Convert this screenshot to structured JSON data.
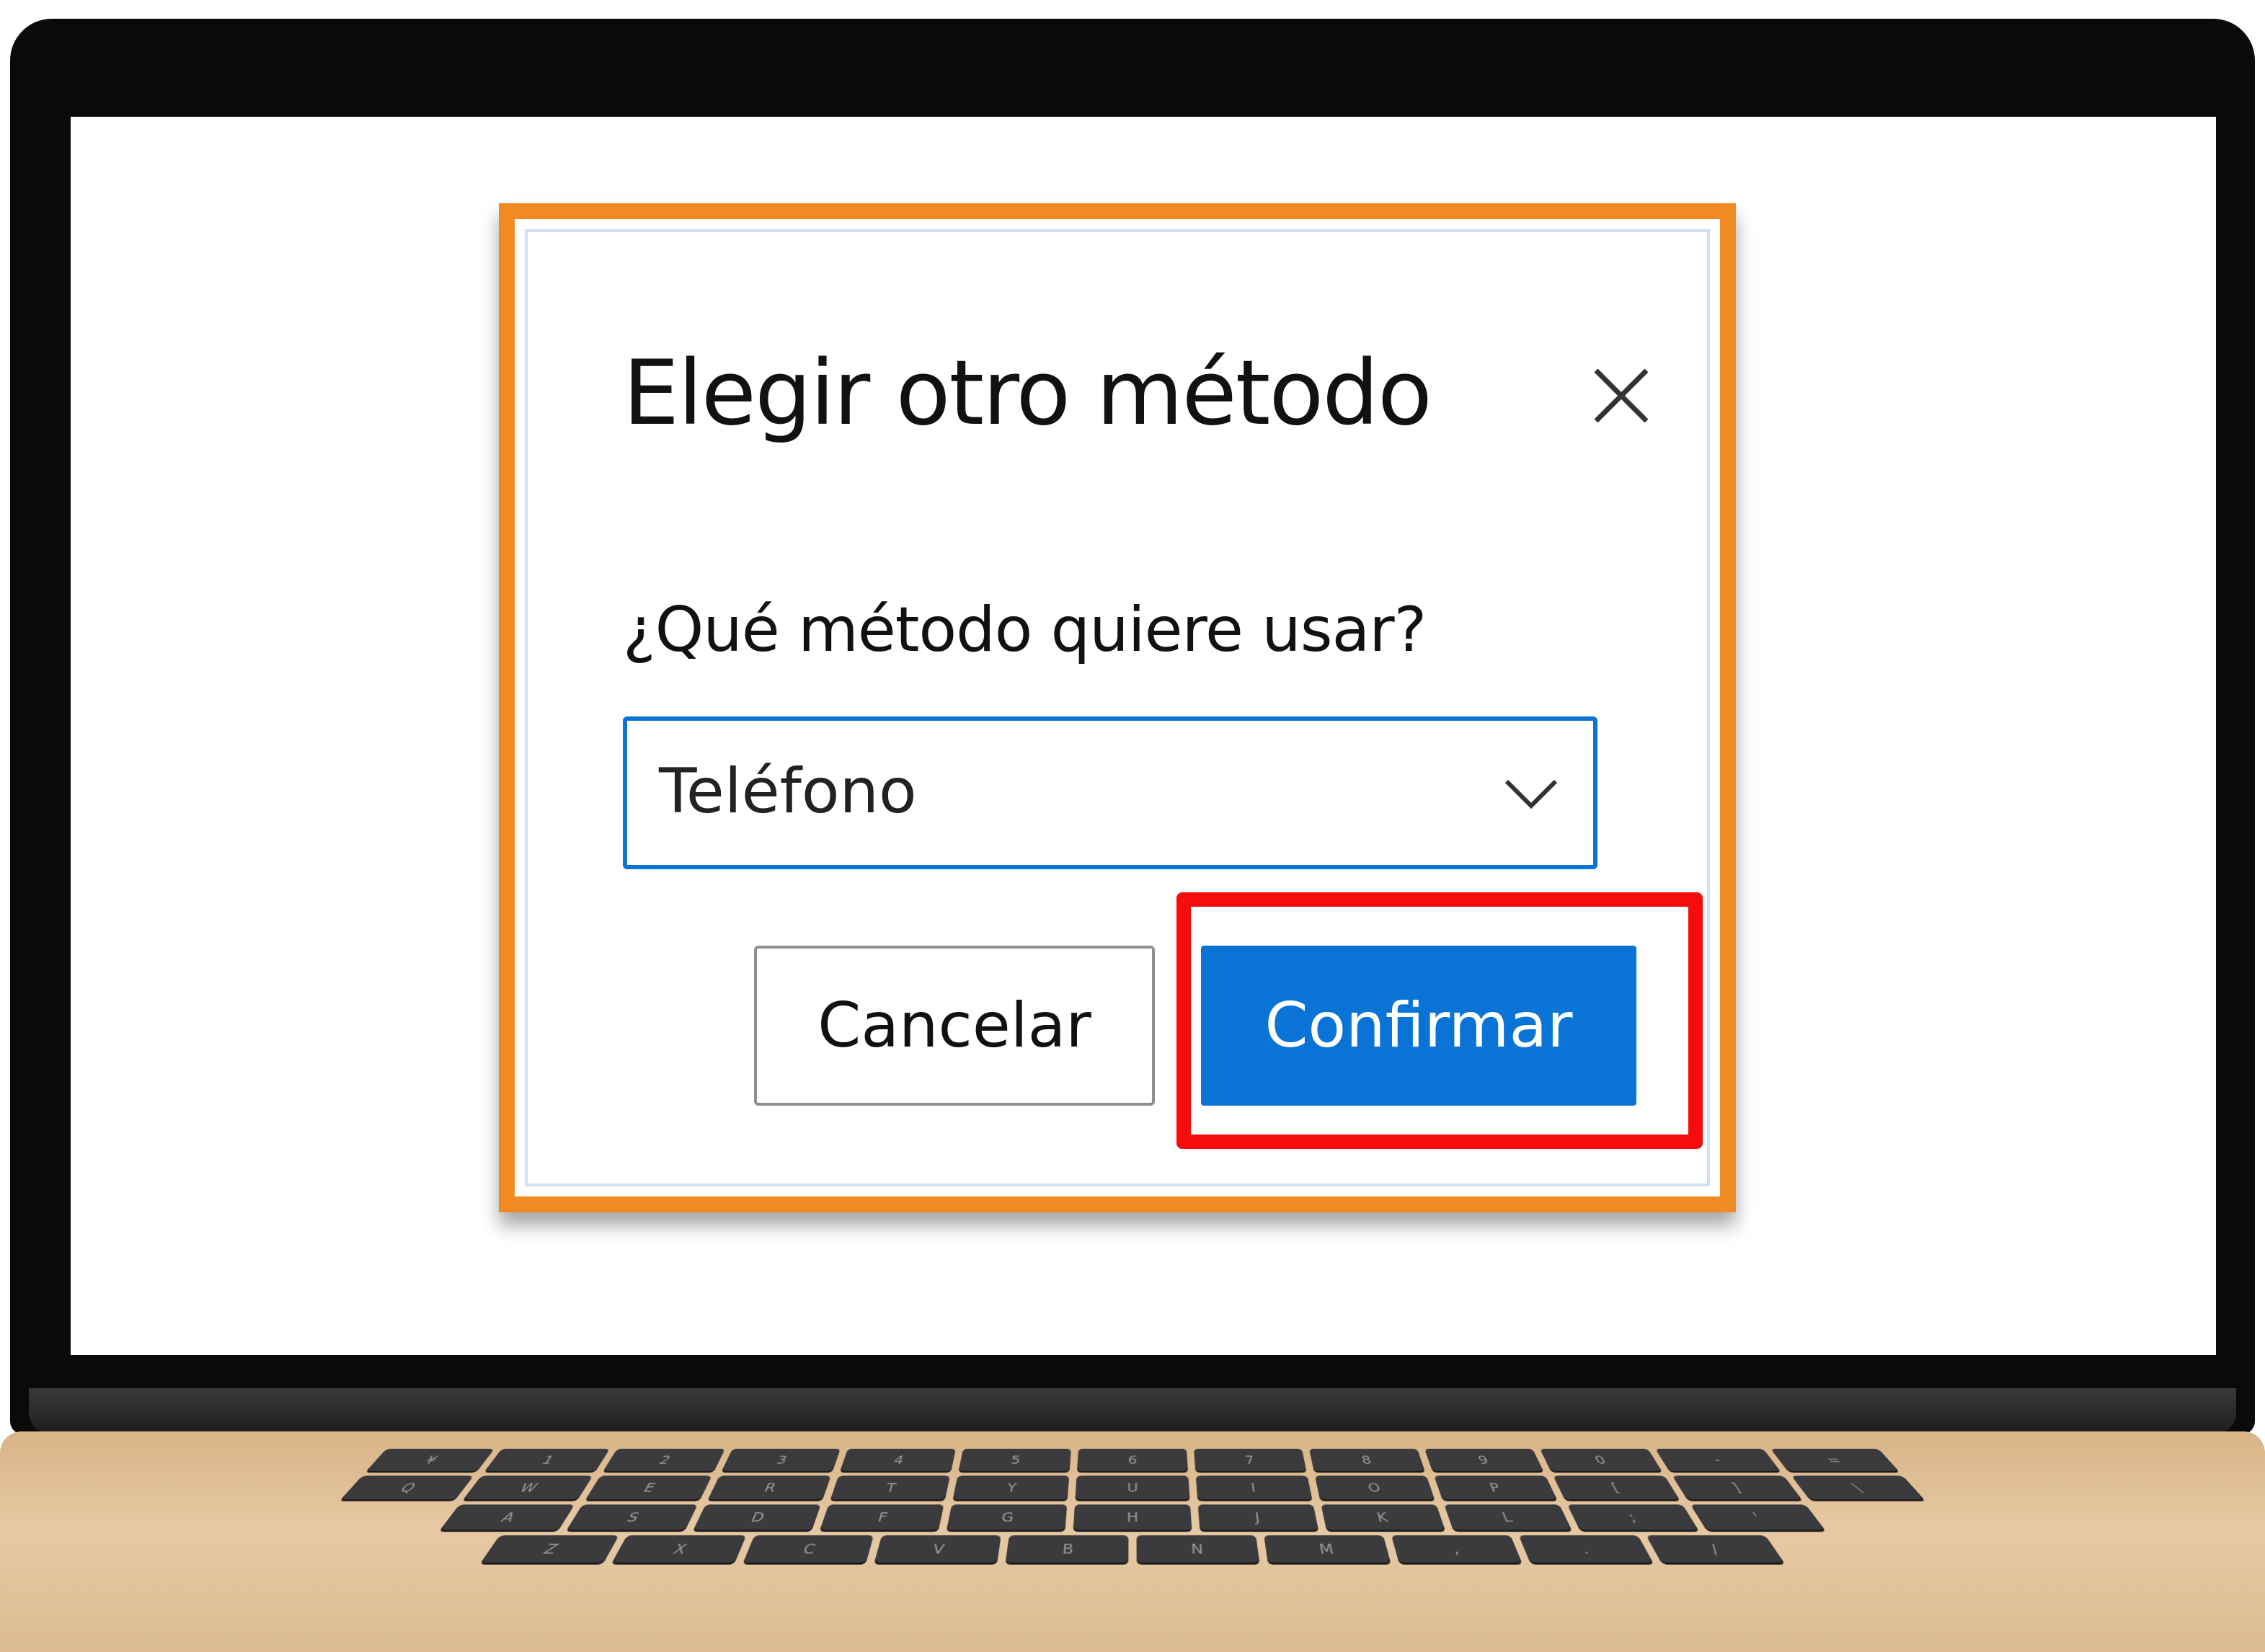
{
  "dialog": {
    "title": "Elegir otro método",
    "close_icon": "close-icon",
    "question": "¿Qué método quiere usar?",
    "select": {
      "value": "Teléfono",
      "icon": "chevron-down-icon"
    },
    "cancel_label": "Cancelar",
    "confirm_label": "Confirmar"
  },
  "colors": {
    "dialog_border": "#f28a24",
    "highlight": "#f50c0c",
    "primary": "#0a74d6",
    "laptop_base": "#d9b487"
  },
  "keyboard": {
    "rows": [
      [
        "¥",
        "1",
        "2",
        "3",
        "4",
        "5",
        "6",
        "7",
        "8",
        "9",
        "0",
        "-",
        "="
      ],
      [
        "Q",
        "W",
        "E",
        "R",
        "T",
        "Y",
        "U",
        "I",
        "O",
        "P",
        "[",
        "]",
        "\\"
      ],
      [
        "A",
        "S",
        "D",
        "F",
        "G",
        "H",
        "J",
        "K",
        "L",
        ";",
        "'"
      ],
      [
        "Z",
        "X",
        "C",
        "V",
        "B",
        "N",
        "M",
        ",",
        ".",
        "/"
      ]
    ]
  }
}
